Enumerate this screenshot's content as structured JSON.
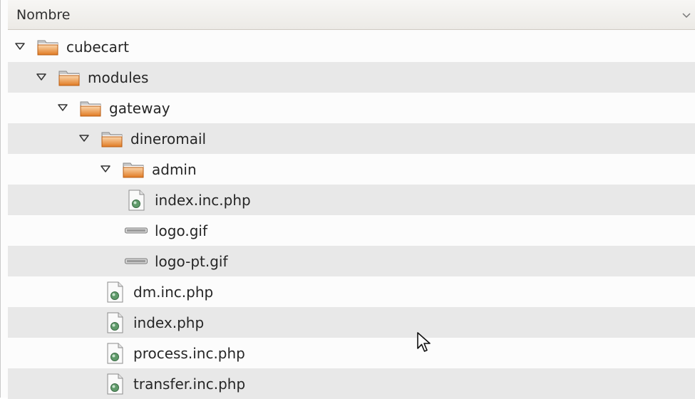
{
  "header": {
    "column_label": "Nombre"
  },
  "tree": [
    {
      "label": "cubecart",
      "type": "folder",
      "depth": 0,
      "expanded": true,
      "icon": "folder-icon"
    },
    {
      "label": "modules",
      "type": "folder",
      "depth": 1,
      "expanded": true,
      "icon": "folder-icon"
    },
    {
      "label": "gateway",
      "type": "folder",
      "depth": 2,
      "expanded": true,
      "icon": "folder-icon"
    },
    {
      "label": "dineromail",
      "type": "folder",
      "depth": 3,
      "expanded": true,
      "icon": "folder-icon"
    },
    {
      "label": "admin",
      "type": "folder",
      "depth": 4,
      "expanded": true,
      "icon": "folder-icon"
    },
    {
      "label": "index.inc.php",
      "type": "php",
      "depth": 5,
      "icon": "php-file-icon"
    },
    {
      "label": "logo.gif",
      "type": "image",
      "depth": 5,
      "icon": "image-file-icon"
    },
    {
      "label": "logo-pt.gif",
      "type": "image",
      "depth": 5,
      "icon": "image-file-icon"
    },
    {
      "label": "dm.inc.php",
      "type": "php",
      "depth": 4,
      "icon": "php-file-icon"
    },
    {
      "label": "index.php",
      "type": "php",
      "depth": 4,
      "icon": "php-file-icon"
    },
    {
      "label": "process.inc.php",
      "type": "php",
      "depth": 4,
      "icon": "php-file-icon"
    },
    {
      "label": "transfer.inc.php",
      "type": "php",
      "depth": 4,
      "icon": "php-file-icon"
    }
  ],
  "colors": {
    "folder_orange": "#e8852c",
    "row_alt": "#e8e8e8",
    "header_bg": "#eceae6"
  }
}
